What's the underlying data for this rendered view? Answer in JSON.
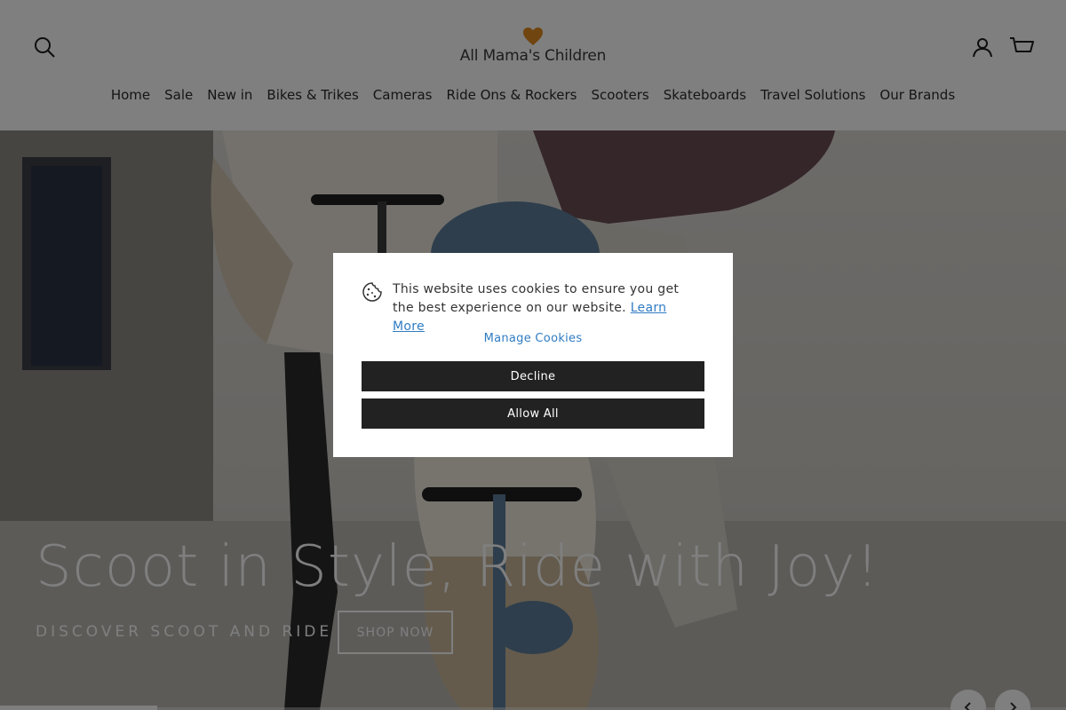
{
  "header": {
    "logo_text": "All Mama's Children",
    "nav": [
      "Home",
      "Sale",
      "New in",
      "Bikes & Trikes",
      "Cameras",
      "Ride Ons & Rockers",
      "Scooters",
      "Skateboards",
      "Travel Solutions",
      "Our Brands"
    ]
  },
  "hero": {
    "title": "Scoot in Style, Ride with Joy!",
    "subtitle": "DISCOVER SCOOT AND RIDE",
    "cta": "SHOP NOW"
  },
  "cookie": {
    "message": "This website uses cookies to ensure you get the best experience on our website.",
    "learn_more": "Learn More",
    "manage": "Manage Cookies",
    "decline": "Decline",
    "allow_all": "Allow All"
  },
  "colors": {
    "accent_link": "#2f7cc3",
    "button_dark": "#222222",
    "logo_heart": "#e08a1e"
  },
  "icons": [
    "search-icon",
    "account-icon",
    "cart-icon",
    "heart-logo-icon",
    "cookie-icon",
    "chevron-left-icon",
    "chevron-right-icon"
  ]
}
